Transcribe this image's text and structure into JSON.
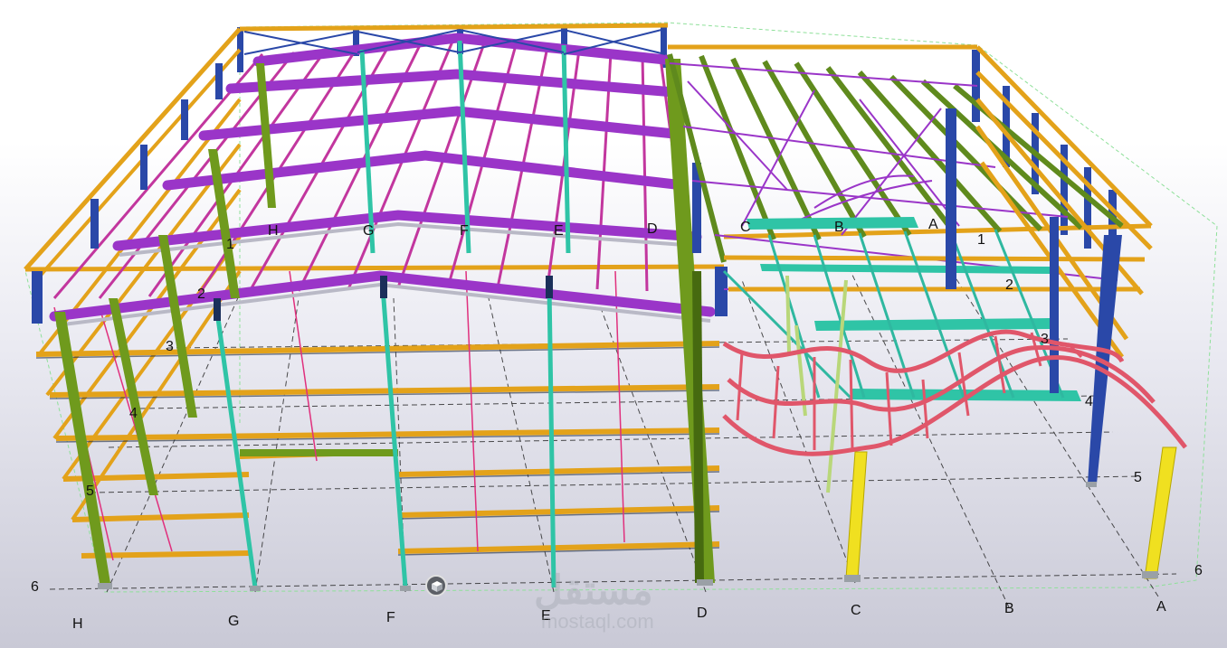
{
  "grid_labels": {
    "bottom_letters": [
      "H",
      "G",
      "F",
      "E",
      "D",
      "C",
      "B",
      "A"
    ],
    "top_letters_left": [
      "H",
      "G",
      "F",
      "E",
      "D"
    ],
    "top_letters_right": [
      "C",
      "B",
      "A"
    ],
    "left_numbers": [
      "1",
      "2",
      "3",
      "4",
      "5",
      "6"
    ],
    "right_numbers": [
      "1",
      "2",
      "3",
      "4",
      "5",
      "6"
    ]
  },
  "watermark": {
    "line1": "مستقل",
    "line2": "mostaql.com"
  },
  "colors": {
    "column_green": "#6f9a1d",
    "column_blue": "#2a48a8",
    "girt_orange": "#e3a21a",
    "rafter_purple": "#9a35c8",
    "purlin_magenta": "#c2369e",
    "brace_pink": "#e0307d",
    "teal_member": "#2fc4a6",
    "curved_red": "#e0566a",
    "yellow_column": "#f0e020",
    "bbox_green": "#7fdc8a"
  },
  "view_cube_icon": "cube-icon"
}
